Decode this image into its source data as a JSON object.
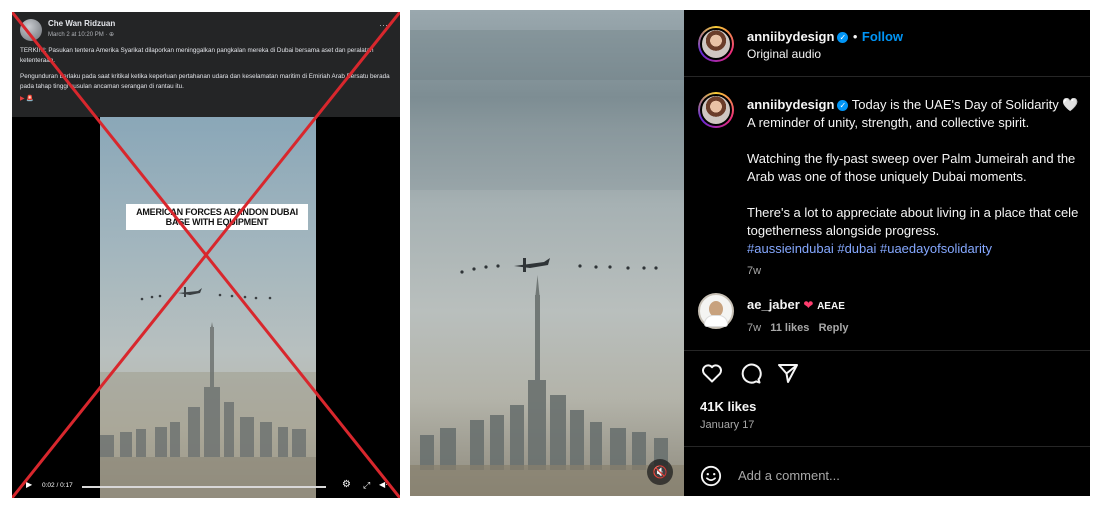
{
  "facebook": {
    "author": "Che Wan Ridzuan",
    "date": "March 2 at 10:20 PM · ",
    "more": "···",
    "text_1": "TERKINI: Pasukan tentera Amerika Syarikat dilaporkan meninggalkan pangkalan mereka di Dubai bersama aset dan peralatan ketenteraan.",
    "text_2": "Pengunduran berlaku pada saat kritikal ketika keperluan pertahanan udara dan keselamatan maritim di Emiriah Arab Bersatu berada pada tahap tinggi susulan ancaman serangan di rantau itu.",
    "flag": "▶ 🚨",
    "video_caption": "AMERICAN FORCES ABANDON DUBAI BASE WITH EQUIPMENT",
    "video_time": "0:02 / 0:17",
    "colors": {
      "cross": "#d8272d",
      "background": "#242526"
    }
  },
  "instagram": {
    "username": "anniibydesign",
    "follow": "Follow",
    "separator": "•",
    "audio": "Original audio",
    "caption_intro": "Today is the UAE's Day of Solidarity 🤍",
    "caption_line_2": "A reminder of unity, strength, and collective spirit.",
    "caption_p2_l1": "Watching the fly-past sweep over Palm Jumeirah and the",
    "caption_p2_l2": "Arab was one of those uniquely Dubai moments.",
    "caption_p3_l1": "There's a lot to appreciate about living in a place that cele",
    "caption_p3_l2": "togetherness alongside progress.",
    "hashtags": "#aussieindubai #dubai #uaedayofsolidarity",
    "caption_age": "7w",
    "comment": {
      "user": "ae_jaber",
      "text": "AEAE",
      "age": "7w",
      "likes": "11 likes",
      "reply": "Reply"
    },
    "likes": "41K likes",
    "date": "January 17",
    "add_comment_placeholder": "Add a comment...",
    "icons": [
      "heart-icon",
      "comment-icon",
      "share-icon",
      "emoji-icon",
      "mute-icon",
      "verified-icon"
    ],
    "colors": {
      "link": "#0095f6",
      "panel": "#000000"
    }
  }
}
